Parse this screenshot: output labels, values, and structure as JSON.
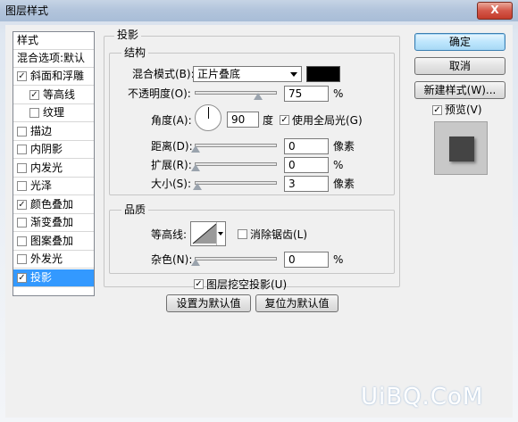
{
  "window": {
    "title": "图层样式",
    "close": "X"
  },
  "style_list": {
    "header": "样式",
    "blend_header": "混合选项:默认",
    "items": [
      {
        "label": "斜面和浮雕",
        "checked": true
      },
      {
        "label": "等高线",
        "checked": true
      },
      {
        "label": "纹理",
        "checked": false
      },
      {
        "label": "描边",
        "checked": false
      },
      {
        "label": "内阴影",
        "checked": false
      },
      {
        "label": "内发光",
        "checked": false
      },
      {
        "label": "光泽",
        "checked": false
      },
      {
        "label": "颜色叠加",
        "checked": true
      },
      {
        "label": "渐变叠加",
        "checked": false
      },
      {
        "label": "图案叠加",
        "checked": false
      },
      {
        "label": "外发光",
        "checked": false
      },
      {
        "label": "投影",
        "checked": true,
        "selected": true
      }
    ]
  },
  "drop_shadow": {
    "section_title": "投影",
    "structure": {
      "title": "结构",
      "blend_mode_label": "混合模式(B):",
      "blend_mode_value": "正片叠底",
      "shadow_color": "#000000",
      "opacity_label": "不透明度(O):",
      "opacity_value": "75",
      "opacity_unit": "%",
      "opacity_fraction": 0.75,
      "angle_label": "角度(A):",
      "angle_value": "90",
      "angle_unit": "度",
      "global_light_label": "使用全局光(G)",
      "global_light_checked": true,
      "distance_label": "距离(D):",
      "distance_value": "0",
      "distance_unit": "像素",
      "spread_label": "扩展(R):",
      "spread_value": "0",
      "spread_unit": "%",
      "size_label": "大小(S):",
      "size_value": "3",
      "size_unit": "像素"
    },
    "quality": {
      "title": "品质",
      "contour_label": "等高线:",
      "antialias_label": "消除锯齿(L)",
      "antialias_checked": false,
      "noise_label": "杂色(N):",
      "noise_value": "0",
      "noise_unit": "%"
    },
    "knockout_label": "图层挖空投影(U)",
    "knockout_checked": true,
    "make_default": "设置为默认值",
    "reset_default": "复位为默认值"
  },
  "buttons": {
    "ok": "确定",
    "cancel": "取消",
    "new_style": "新建样式(W)...",
    "preview_label": "预览(V)",
    "preview_checked": true
  },
  "watermark": "UiBQ.CoM"
}
